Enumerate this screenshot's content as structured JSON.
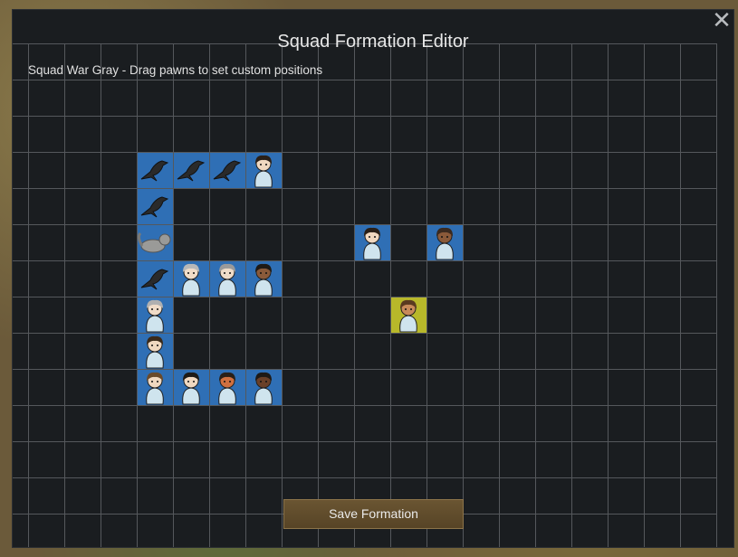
{
  "window": {
    "title": "Squad Formation Editor",
    "subtitle": "Squad War Gray - Drag pawns to set custom positions",
    "close_icon": "close-icon"
  },
  "formation": {
    "save_label": "Save Formation",
    "cells": [
      {
        "col": 3,
        "row": 2,
        "kind": "raven"
      },
      {
        "col": 4,
        "row": 2,
        "kind": "raven"
      },
      {
        "col": 5,
        "row": 2,
        "kind": "raven"
      },
      {
        "col": 6,
        "row": 2,
        "kind": "colonist",
        "hair": "#2a2018",
        "skin": "#f0d8c0"
      },
      {
        "col": 3,
        "row": 3,
        "kind": "raven"
      },
      {
        "col": 3,
        "row": 4,
        "kind": "cat"
      },
      {
        "col": 9,
        "row": 4,
        "kind": "colonist",
        "hair": "#2a2018",
        "skin": "#f0d8c0"
      },
      {
        "col": 11,
        "row": 4,
        "kind": "colonist",
        "hair": "#3a2a20",
        "skin": "#8a5a3a"
      },
      {
        "col": 3,
        "row": 5,
        "kind": "raven"
      },
      {
        "col": 4,
        "row": 5,
        "kind": "colonist",
        "hair": "#b8b8b8",
        "skin": "#f0dcc8"
      },
      {
        "col": 5,
        "row": 5,
        "kind": "colonist",
        "hair": "#9a9a9a",
        "skin": "#eedcc8"
      },
      {
        "col": 6,
        "row": 5,
        "kind": "colonist",
        "hair": "#1e1a16",
        "skin": "#8a5a3a"
      },
      {
        "col": 3,
        "row": 6,
        "kind": "colonist",
        "hair": "#b0b0b0",
        "skin": "#f0dcc8"
      },
      {
        "col": 10,
        "row": 6,
        "kind": "colonist",
        "hair": "#5a3a20",
        "skin": "#c88a5a",
        "selected": true
      },
      {
        "col": 3,
        "row": 7,
        "kind": "colonist",
        "hair": "#3a2a1a",
        "skin": "#f0d8c0"
      },
      {
        "col": 3,
        "row": 8,
        "kind": "colonist",
        "hair": "#6a4a2a",
        "skin": "#f0d8c0"
      },
      {
        "col": 4,
        "row": 8,
        "kind": "colonist",
        "hair": "#1e1a16",
        "skin": "#f0d8c0"
      },
      {
        "col": 5,
        "row": 8,
        "kind": "colonist",
        "hair": "#2a2018",
        "skin": "#d07040"
      },
      {
        "col": 6,
        "row": 8,
        "kind": "colonist",
        "hair": "#1e1a16",
        "skin": "#6a4028"
      }
    ]
  },
  "colors": {
    "cell_blue": "#2f6fb5",
    "cell_selected": "#b8b82a",
    "grid_line": "#55585c",
    "raven": "#2a2a2a",
    "cat": "#9a9a98",
    "clothing": "#cfe4ee"
  }
}
